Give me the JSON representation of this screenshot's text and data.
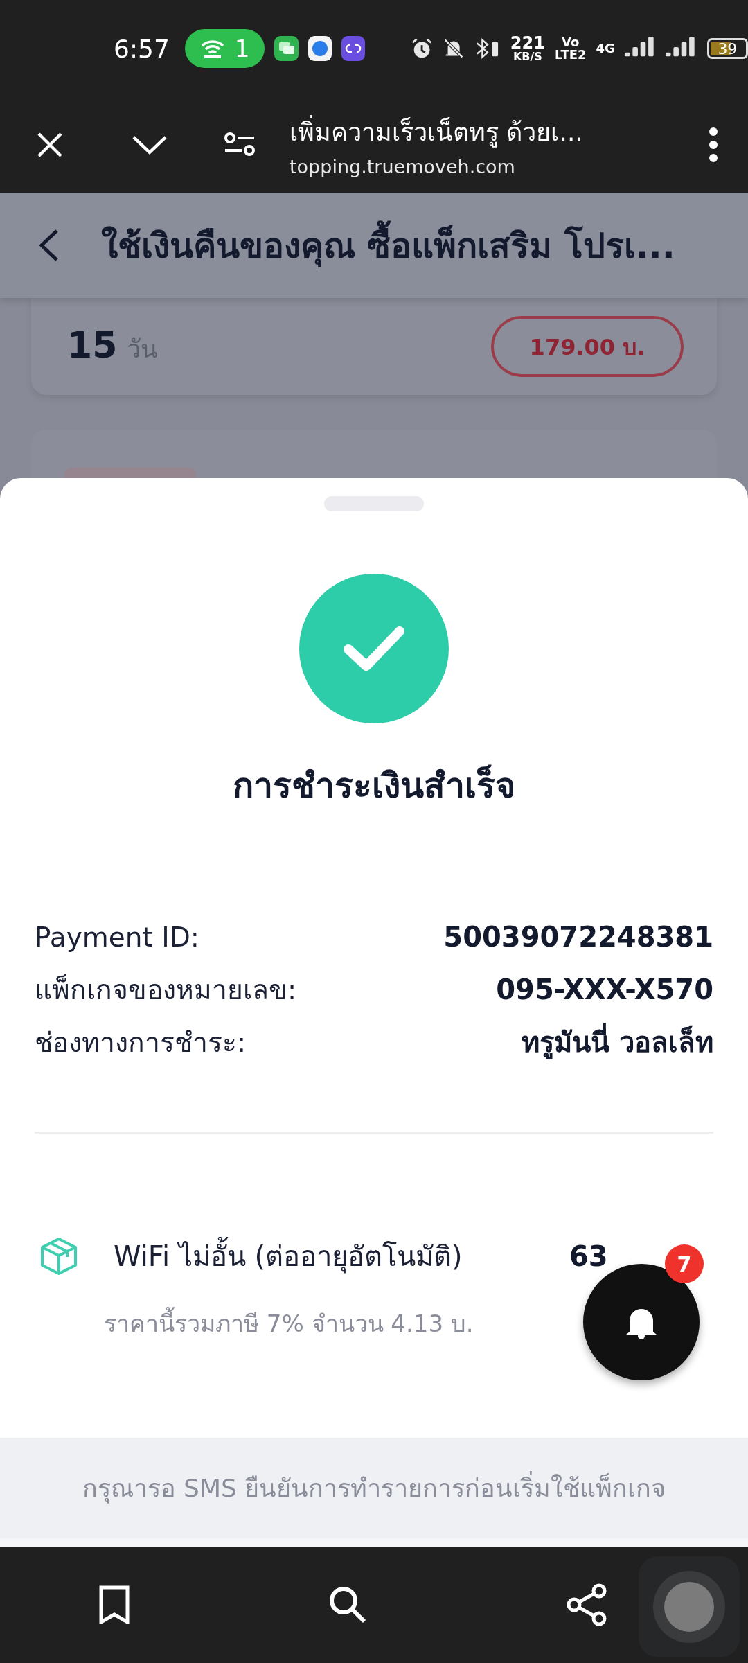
{
  "status_bar": {
    "time": "6:57",
    "hotspot_count": "1",
    "net_speed": [
      "221",
      "KB/S"
    ],
    "volte": [
      "Vo",
      "LTE2"
    ],
    "network_type": "4G",
    "battery": "39"
  },
  "browser_bar": {
    "title": "เพิ่มความเร็วเน็ตทรู ด้วยเ...",
    "url": "topping.truemoveh.com"
  },
  "page": {
    "title": "ใช้เงินคืนของคุณ ซื้อแพ็กเสริม โปรเ...",
    "card": {
      "days": "15",
      "days_unit": "วัน",
      "price": "179.00 บ."
    }
  },
  "sheet": {
    "title": "การชำระเงินสำเร็จ",
    "details": [
      {
        "label": "Payment ID:",
        "value": "50039072248381"
      },
      {
        "label": "แพ็กเกจของหมายเลข:",
        "value": "095-XXX-X570"
      },
      {
        "label": "ช่องทางการชำระ:",
        "value": "ทรูมันนี่ วอลเล็ท"
      }
    ],
    "item": {
      "name": "WiFi ไม่อั้น (ต่ออายุอัตโนมัติ)",
      "price": "63",
      "tax_note": "ราคานี้รวมภาษี 7% จำนวน 4.13 บ."
    },
    "notification_count": "7",
    "footer_note": "กรุณารอ SMS ยืนยันการทำรายการก่อนเริ่มใช้แพ็กเกจ"
  }
}
